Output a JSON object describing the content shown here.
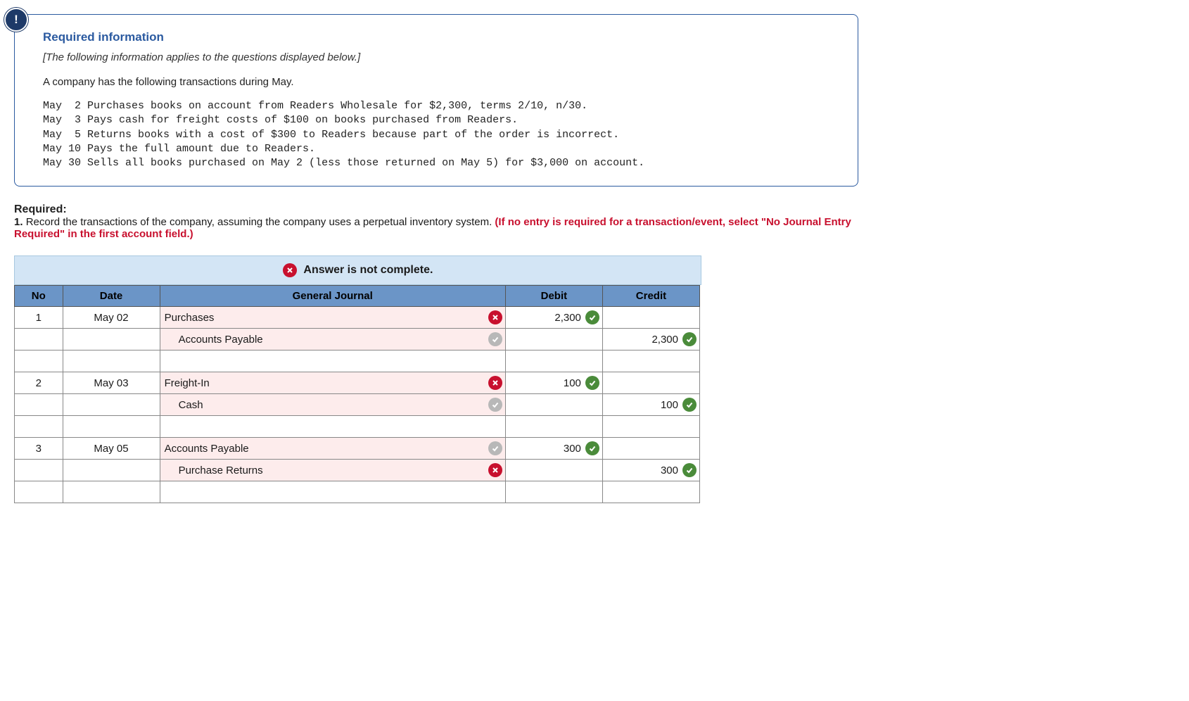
{
  "info": {
    "header": "Required information",
    "subtitle": "[The following information applies to the questions displayed below.]",
    "intro": "A company has the following transactions during May.",
    "transactions": "May  2 Purchases books on account from Readers Wholesale for $2,300, terms 2/10, n/30.\nMay  3 Pays cash for freight costs of $100 on books purchased from Readers.\nMay  5 Returns books with a cost of $300 to Readers because part of the order is incorrect.\nMay 10 Pays the full amount due to Readers.\nMay 30 Sells all books purchased on May 2 (less those returned on May 5) for $3,000 on account."
  },
  "required": {
    "label": "Required:",
    "text_prefix": "1. ",
    "text_main": "Record the transactions of the company, assuming the company uses a perpetual inventory system. ",
    "text_red": "(If no entry is required for a transaction/event, select \"No Journal Entry Required\" in the first account field.)"
  },
  "status": "Answer is not complete.",
  "table": {
    "headers": {
      "no": "No",
      "date": "Date",
      "gj": "General Journal",
      "debit": "Debit",
      "credit": "Credit"
    },
    "rows": [
      {
        "no": "1",
        "date": "May 02",
        "account": "Purchases",
        "acc_status": "wrong",
        "pink": true,
        "indent": false,
        "debit": "2,300",
        "debit_status": "correct",
        "credit": "",
        "credit_status": ""
      },
      {
        "no": "",
        "date": "",
        "account": "Accounts Payable",
        "acc_status": "neutral",
        "pink": true,
        "indent": true,
        "debit": "",
        "debit_status": "",
        "credit": "2,300",
        "credit_status": "correct"
      },
      {
        "no": "",
        "date": "",
        "account": "",
        "acc_status": "",
        "pink": false,
        "indent": false,
        "debit": "",
        "debit_status": "",
        "credit": "",
        "credit_status": ""
      },
      {
        "no": "2",
        "date": "May 03",
        "account": "Freight-In",
        "acc_status": "wrong",
        "pink": true,
        "indent": false,
        "debit": "100",
        "debit_status": "correct",
        "credit": "",
        "credit_status": ""
      },
      {
        "no": "",
        "date": "",
        "account": "Cash",
        "acc_status": "neutral",
        "pink": true,
        "indent": true,
        "debit": "",
        "debit_status": "",
        "credit": "100",
        "credit_status": "correct"
      },
      {
        "no": "",
        "date": "",
        "account": "",
        "acc_status": "",
        "pink": false,
        "indent": false,
        "debit": "",
        "debit_status": "",
        "credit": "",
        "credit_status": ""
      },
      {
        "no": "3",
        "date": "May 05",
        "account": "Accounts Payable",
        "acc_status": "neutral",
        "pink": true,
        "indent": false,
        "debit": "300",
        "debit_status": "correct",
        "credit": "",
        "credit_status": ""
      },
      {
        "no": "",
        "date": "",
        "account": "Purchase Returns",
        "acc_status": "wrong",
        "pink": true,
        "indent": true,
        "debit": "",
        "debit_status": "",
        "credit": "300",
        "credit_status": "correct"
      },
      {
        "no": "",
        "date": "",
        "account": "",
        "acc_status": "",
        "pink": false,
        "indent": false,
        "debit": "",
        "debit_status": "",
        "credit": "",
        "credit_status": ""
      }
    ]
  }
}
